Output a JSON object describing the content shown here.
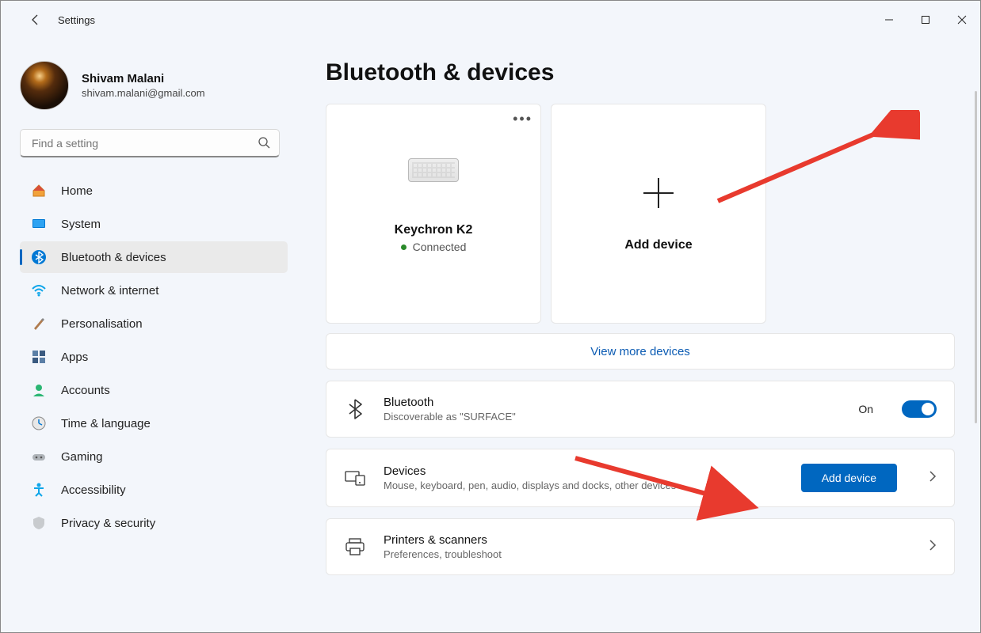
{
  "window": {
    "title": "Settings"
  },
  "profile": {
    "name": "Shivam Malani",
    "email": "shivam.malani@gmail.com"
  },
  "search": {
    "placeholder": "Find a setting"
  },
  "nav": {
    "items": [
      {
        "label": "Home"
      },
      {
        "label": "System"
      },
      {
        "label": "Bluetooth & devices"
      },
      {
        "label": "Network & internet"
      },
      {
        "label": "Personalisation"
      },
      {
        "label": "Apps"
      },
      {
        "label": "Accounts"
      },
      {
        "label": "Time & language"
      },
      {
        "label": "Gaming"
      },
      {
        "label": "Accessibility"
      },
      {
        "label": "Privacy & security"
      }
    ]
  },
  "page": {
    "heading": "Bluetooth & devices",
    "device_card": {
      "name": "Keychron K2",
      "status": "Connected"
    },
    "add_card": {
      "label": "Add device"
    },
    "view_more": "View more devices",
    "bluetooth_row": {
      "title": "Bluetooth",
      "subtitle": "Discoverable as \"SURFACE\"",
      "state": "On"
    },
    "devices_row": {
      "title": "Devices",
      "subtitle": "Mouse, keyboard, pen, audio, displays and docks, other devices",
      "button": "Add device"
    },
    "printers_row": {
      "title": "Printers & scanners",
      "subtitle": "Preferences, troubleshoot"
    }
  }
}
